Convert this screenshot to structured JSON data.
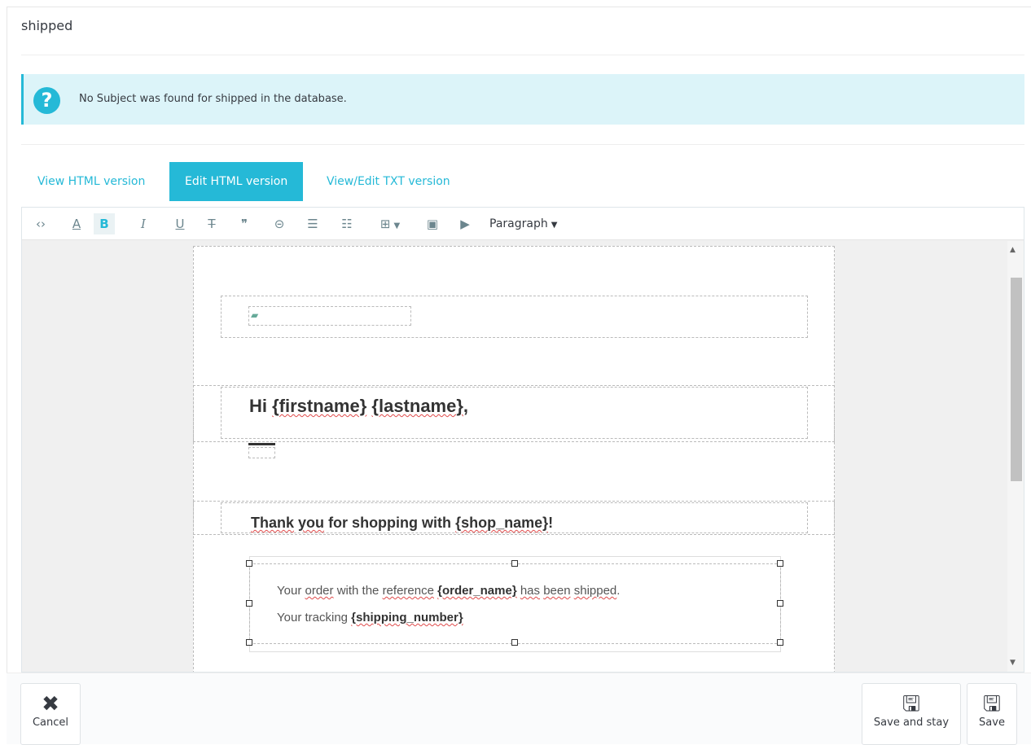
{
  "header": {
    "title": "shipped"
  },
  "alert": {
    "icon": "question-icon",
    "text": "No Subject was found for shipped in the database."
  },
  "tabs": [
    {
      "label": "View HTML version",
      "active": false
    },
    {
      "label": "Edit HTML version",
      "active": true
    },
    {
      "label": "View/Edit TXT version",
      "active": false
    }
  ],
  "toolbar": {
    "items": [
      {
        "name": "source-code-icon",
        "glyph": "‹›"
      },
      {
        "name": "text-color-icon",
        "glyph": "A"
      },
      {
        "name": "bold-icon",
        "glyph": "B"
      },
      {
        "name": "italic-icon",
        "glyph": "I"
      },
      {
        "name": "underline-icon",
        "glyph": "U"
      },
      {
        "name": "strikethrough-icon",
        "glyph": "T"
      },
      {
        "name": "blockquote-icon",
        "glyph": "❞"
      },
      {
        "name": "link-icon",
        "glyph": "⊝"
      },
      {
        "name": "bullet-list-icon",
        "glyph": "☰"
      },
      {
        "name": "numbered-list-icon",
        "glyph": "☷"
      },
      {
        "name": "table-icon",
        "glyph": "⊞"
      },
      {
        "name": "image-icon",
        "glyph": "▣"
      },
      {
        "name": "media-icon",
        "glyph": "▶"
      }
    ],
    "format_select": "Paragraph"
  },
  "email": {
    "greeting_prefix": "Hi",
    "firstname": "{firstname}",
    "lastname": "{lastname}",
    "greeting_suffix": ",",
    "thank_prefix": "Thank",
    "thank_you": "you",
    "thank_mid": "for shopping with",
    "shop_name": "{shop_name}",
    "thank_suffix": "!",
    "line1_a": "Your",
    "line1_order": "order",
    "line1_b": "with the",
    "line1_reference": "reference",
    "line1_order_name": "{order_name}",
    "line1_has": "has",
    "line1_been": "been",
    "line1_shipped": "shipped",
    "line1_end": ".",
    "line2_a": "Your tracking",
    "line2_number": "{shipping_number}"
  },
  "footer": {
    "cancel_label": "Cancel",
    "save_stay_label": "Save and stay",
    "save_label": "Save"
  }
}
